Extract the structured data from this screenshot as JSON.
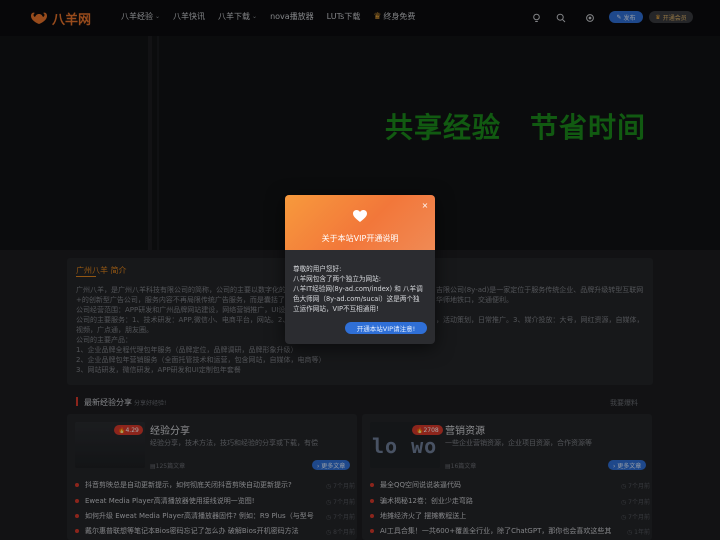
{
  "brand": {
    "name": "八羊网",
    "accent": "#e8732c"
  },
  "nav": {
    "items": [
      {
        "label": "八羊经验",
        "caret": "⌄"
      },
      {
        "label": "八羊快讯",
        "caret": ""
      },
      {
        "label": "八羊下载",
        "caret": "⌄"
      },
      {
        "label": "nova播放器",
        "caret": ""
      },
      {
        "label": "LUTs下载",
        "caret": ""
      },
      {
        "label": "终身免费",
        "caret": ""
      }
    ]
  },
  "header": {
    "publish_label": "发布",
    "vip_label": "开通会员",
    "icons": [
      "bulb-icon",
      "search-icon",
      "theme-toggle-icon"
    ]
  },
  "hero": {
    "slogan": "共享经验　节省时间",
    "slogan_color": "#1b8a1b"
  },
  "intro": {
    "title": "广州八羊 简介",
    "lines": [
      "广州八羊，是广州八羊科技有限公司的简称，公司的主要以数字化的",
      "+的创新型广告公司，服务内容不再局限传统广告服务，而是囊括了",
      "公司经营范围：APP研发和广州品牌网站建设，网络营销推广，UI设",
      "公司的主要服务：1、技术研发：APP,微信小、电商平台，网站。2、",
      "视频，广点通，朋友圈。",
      "公司的主要产品：",
      "1、企业品牌全程代理包年服务（品牌定位，品牌调研，品牌形象升级）",
      "2、企业品牌包年营销服务（全面托管技术和运营，包含网站，自媒体，电商等）",
      "3、网站研发，微信研发，APP研发和UI定制包年套餐"
    ],
    "right_fragments": [
      "吉限公司(8y-ad)是一家定位于服务传统企业、品牌升级转型互联网",
      "华师地铁口，交通便利。",
      "，活动策划，日常推广。3、媒介投放：大号，网红资源，自媒体，"
    ]
  },
  "section": {
    "title": "最新经验分享",
    "subtitle": "分享好经验!",
    "right_link": "我要爆料"
  },
  "cards": [
    {
      "badge": "🔥4.29",
      "title": "经验分享",
      "desc": "经验分享，技术方法，技巧和经验的分享或下载，有偿",
      "count": "125篇文章",
      "more": "› 更多文章",
      "items": [
        {
          "text": "抖音剪映总是自动更新提示，如何彻底关闭抖音剪映自动更新提示?",
          "ago": "◷ 7个月前"
        },
        {
          "text": "Eweat Media Player高清播放器使用接线说明一览图!",
          "ago": "◷ 7个月前"
        },
        {
          "text": "如何升级 Eweat Media Player高清播放器固件? 例如：R9 Plus（与型号",
          "ago": "◷ 7个月前"
        },
        {
          "text": "戴尔惠普联想等笔记本Bios密码忘记了怎么办 破解Bios开机密码方法",
          "ago": "◷ 8个月前"
        }
      ]
    },
    {
      "badge": "🔥2708",
      "thumb_text": "lo wo",
      "title": "营销资源",
      "desc": "一些企业营销资源，企业项目资源，合作资源等",
      "count": "16篇文章",
      "more": "› 更多文章",
      "items": [
        {
          "text": "最全QQ空间说说装逼代码",
          "ago": "◷ 7个月前"
        },
        {
          "text": "骗术揭秘12卷：创业少走弯路",
          "ago": "◷ 7个月前"
        },
        {
          "text": "地摊经济火了 摆摊教程送上",
          "ago": "◷ 7个月前"
        },
        {
          "text": "AI工具合集！一共600+覆盖全行业，除了ChatGPT，那你也会喜欢这些其",
          "ago": "◷ 1年前"
        }
      ]
    }
  ],
  "modal": {
    "title": "关于本站VIP开通说明",
    "close": "×",
    "body_lines": [
      "尊敬的用户您好:",
      "八羊网包含了两个独立为网站:",
      "八羊IT经验网(8y-ad.com/index) 和 八羊调",
      "色大师网（8y-ad.com/sucai）这是两个独",
      "立运作网站，VIP不互相通用!"
    ],
    "button": "开通本站VIP请注意!"
  }
}
